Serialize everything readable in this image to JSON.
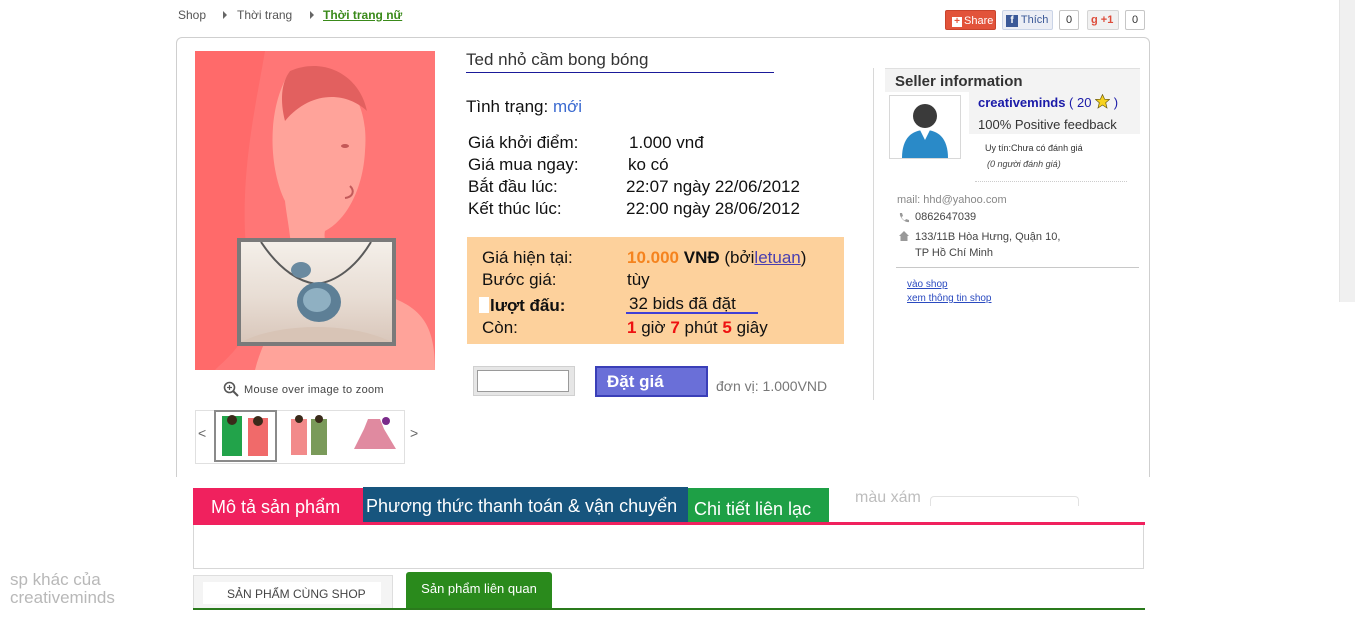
{
  "breadcrumb": {
    "items": [
      "Shop",
      "Thời trang"
    ],
    "current": "Thời trang nữ"
  },
  "social": {
    "share": "Share",
    "fb_like": "Thích",
    "fb_count": "0",
    "gplus_count": "0",
    "gplus_label": "+1"
  },
  "product": {
    "title": "Ted nhỏ cầm bong bóng",
    "condition_label": "Tình trạng:",
    "condition_value": "mới",
    "start_price_label": "Giá khởi điểm:",
    "start_price": "1.000 vnđ",
    "buy_now_label": "Giá mua ngay:",
    "buy_now": "ko có",
    "start_label": "Bắt đầu lúc:",
    "start_time": "22:07 ngày 22/06/2012",
    "end_label": "Kết thúc lúc:",
    "end_time": "22:00 ngày 28/06/2012"
  },
  "bid_box": {
    "current_label": "Giá hiện tại:",
    "current_price": "10.000",
    "currency": "VNĐ",
    "by_prefix": "(bởi",
    "by_user": "letuan",
    "by_suffix": ")",
    "step_label": "Bước giá:",
    "step_value": "tùy",
    "bids_label": "lượt đấu:",
    "bids_value": "32 bids đã đặt",
    "remaining_label": "Còn:",
    "hours": "1",
    "hours_unit": "giờ",
    "minutes": "7",
    "minutes_unit": "phút",
    "seconds": "5",
    "seconds_unit": "giây"
  },
  "bid_form": {
    "input_value": "",
    "button_label": "Đặt  giá",
    "unit": "đơn vị: 1.000VND"
  },
  "image": {
    "zoom_hint": "Mouse over image to zoom",
    "prev": "<",
    "next": ">"
  },
  "seller": {
    "header": "Seller information",
    "name": "creativeminds",
    "score": "20",
    "feedback": "100% Positive feedback",
    "trust": "Uy tín:Chưa có đánh giá",
    "raters": "(0 người đánh giá)",
    "email": "mail: hhd@yahoo.com",
    "phone": "0862647039",
    "address_line1": "133/11B Hòa Hưng, Quận 10,",
    "address_line2": "TP Hồ Chí Minh",
    "link_shop": "vào shop",
    "link_info": "xem thông tin shop"
  },
  "tabs": [
    {
      "label": "Mô tả sản phẩm",
      "color": "#f0215e"
    },
    {
      "label": "Phương thức thanh toán & vận chuyển",
      "color": "#17557e"
    },
    {
      "label": "Chi tiết liên lạc",
      "color": "#1ea046"
    },
    {
      "label": "màu xám",
      "color": "#bdbdbd"
    }
  ],
  "bottom": {
    "other_products": "sp khác của creativeminds",
    "tab_same_shop": "SẢN PHẨM CÙNG SHOP",
    "tab_related": "Sản phẩm liên quan"
  }
}
